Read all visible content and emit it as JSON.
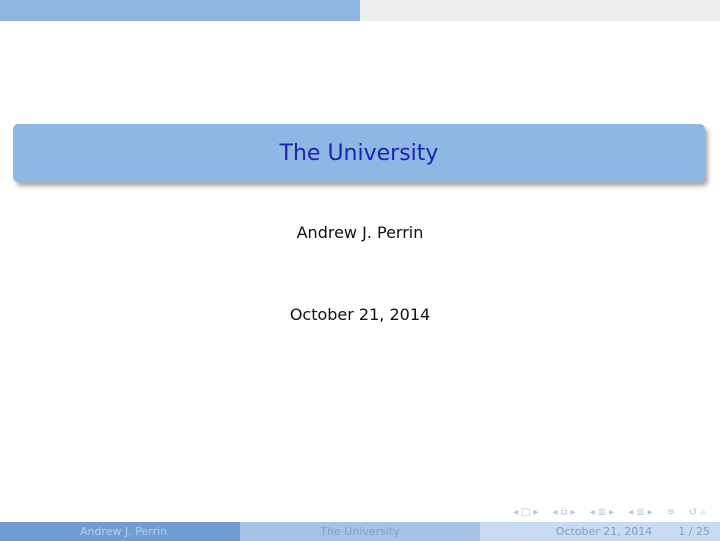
{
  "slide": {
    "title": "The University",
    "author": "Andrew J. Perrin",
    "date": "October 21, 2014"
  },
  "footer": {
    "author": "Andrew J. Perrin",
    "title": "The University",
    "date": "October 21, 2014",
    "page": "1 / 25"
  },
  "colors": {
    "title_box": "#8db8e3",
    "title_text": "#2020b0",
    "header_bar": "#8fb6e0",
    "footer_dark": "#6f9ed4",
    "footer_mid": "#a6c2e6",
    "footer_light": "#c9dbf1"
  },
  "nav_icons": [
    "nav-frame-icon",
    "nav-subsection-icon",
    "nav-section-icon",
    "nav-presentation-icon",
    "nav-back-icon",
    "nav-search-icon"
  ]
}
